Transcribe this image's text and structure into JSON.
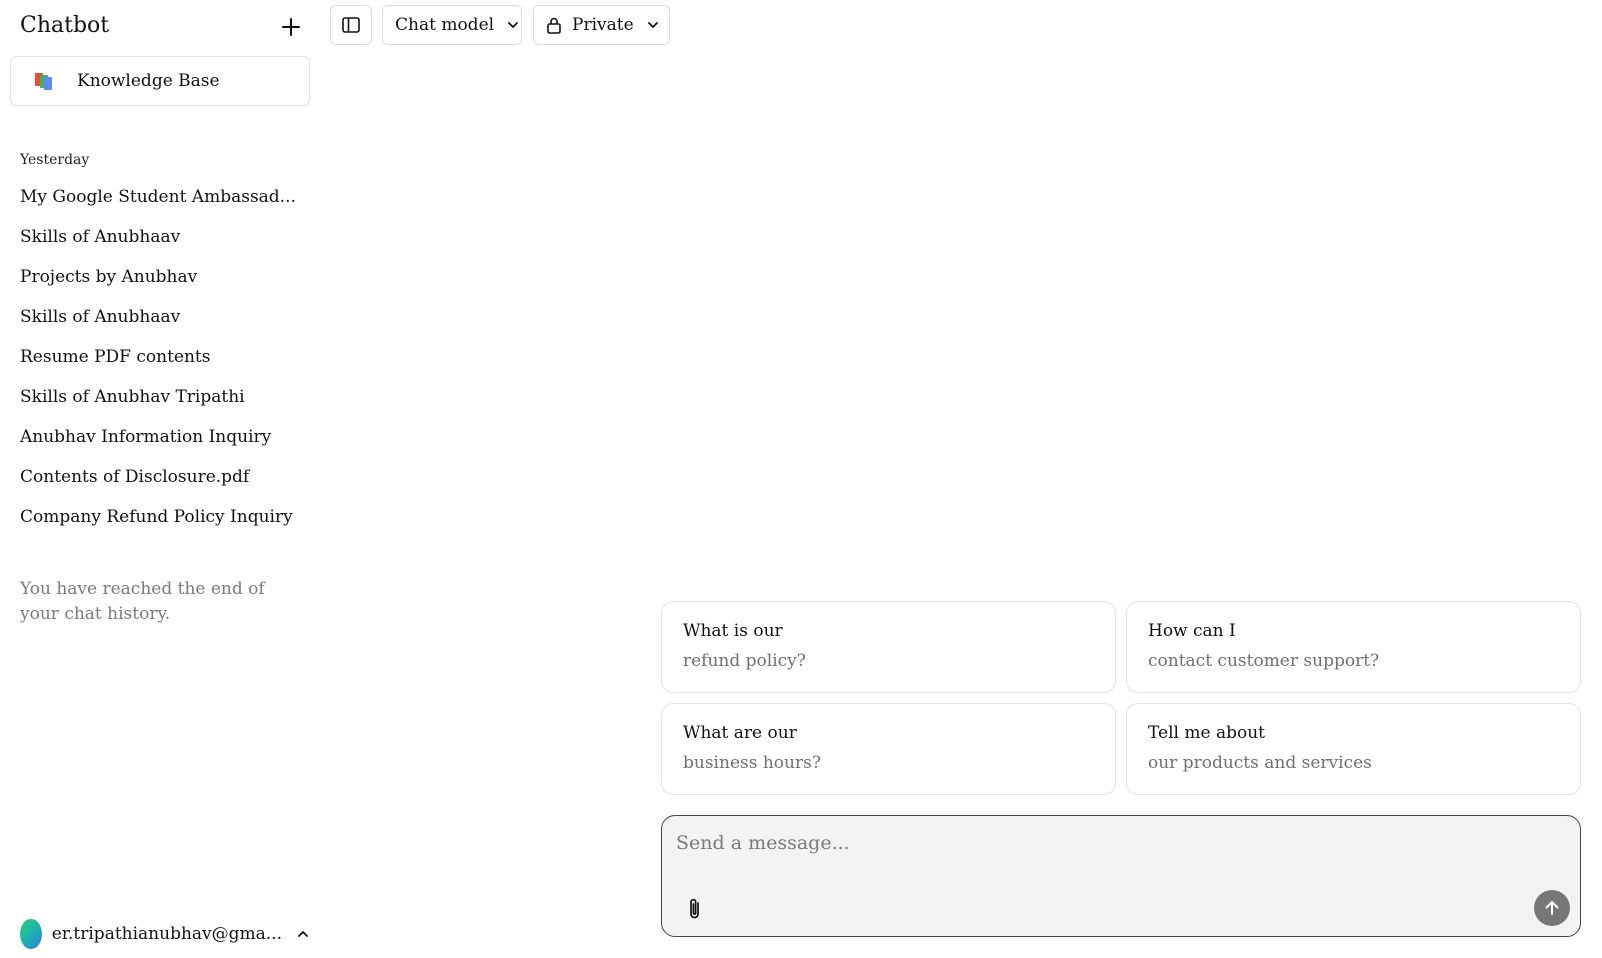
{
  "sidebar": {
    "title": "Chatbot",
    "knowledge_base_label": "Knowledge Base",
    "history_heading": "Yesterday",
    "history": [
      "My Google Student Ambassad...",
      "Skills of Anubhaav",
      "Projects by Anubhav",
      "Skills of Anubhaav",
      "Resume PDF contents",
      "Skills of Anubhav Tripathi",
      "Anubhav Information Inquiry",
      "Contents of Disclosure.pdf",
      "Company Refund Policy Inquiry"
    ],
    "history_end": "You have reached the end of your chat history.",
    "user_email": "er.tripathianubhav@gma..."
  },
  "toolbar": {
    "model_label": "Chat model",
    "visibility_label": "Private"
  },
  "suggestions": [
    {
      "line1": "What is our",
      "line2": "refund policy?"
    },
    {
      "line1": "How can I",
      "line2": "contact customer support?"
    },
    {
      "line1": "What are our",
      "line2": "business hours?"
    },
    {
      "line1": "Tell me about",
      "line2": "our products and services"
    }
  ],
  "composer": {
    "placeholder": "Send a message...",
    "value": ""
  },
  "icons": {
    "new_chat": "plus-icon",
    "sidebar_toggle": "sidebar-toggle-icon",
    "model_dropdown": "chevron-down-icon",
    "visibility": "lock-icon",
    "attach": "paperclip-icon",
    "send": "arrow-up-icon",
    "user_menu": "chevron-up-icon"
  },
  "colors": {
    "send_button": "#777777",
    "composer_bg": "#f3f3f3",
    "muted_text": "#7a7a7a"
  }
}
